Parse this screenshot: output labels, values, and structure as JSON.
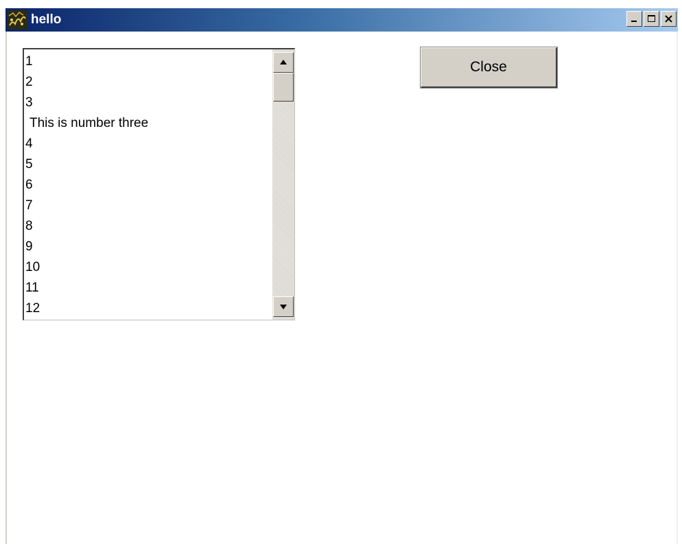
{
  "window": {
    "title": "hello",
    "icon": "java-cup-icon",
    "controls": [
      "minimize-icon",
      "maximize-icon",
      "close-icon"
    ]
  },
  "listbox": {
    "items": [
      "1",
      "2",
      "3",
      "This is number three",
      "4",
      "5",
      "6",
      "7",
      "8",
      "9",
      "10",
      "11",
      "12"
    ]
  },
  "buttons": {
    "close_label": "Close"
  },
  "colors": {
    "titlebar_start": "#0a246a",
    "titlebar_end": "#a6caf0",
    "button_face": "#d4d0c8"
  }
}
